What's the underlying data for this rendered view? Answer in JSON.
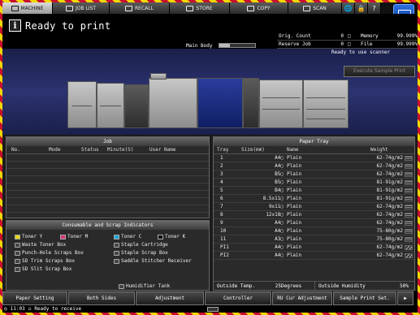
{
  "tabs": [
    {
      "label": "MACHINE",
      "icon": "machine-icon",
      "active": true
    },
    {
      "label": "JOB LIST",
      "icon": "job-list-icon",
      "active": false
    },
    {
      "label": "RECALL",
      "icon": "recall-icon",
      "active": false
    },
    {
      "label": "STORE",
      "icon": "store-icon",
      "active": false
    },
    {
      "label": "COPY",
      "icon": "copy-icon",
      "active": false
    },
    {
      "label": "SCAN",
      "icon": "scan-icon",
      "active": false
    }
  ],
  "tab_extras": {
    "globe": "🌐",
    "lock": "🔒",
    "help": "?"
  },
  "status": {
    "title": "Ready to print",
    "main_body_label": "Main Body",
    "main_body_level": 0.3,
    "orig_count_label": "Orig. Count",
    "orig_count_value": "0",
    "memory_label": "Memory",
    "memory_value": "99.999%",
    "reserve_job_label": "Reserve Job",
    "reserve_job_value": "0",
    "file_amount_label": "File Amount",
    "file_amount_value": "99.999%",
    "scanner_message": "Ready to use scanner",
    "exec_sample_label": "Execute Sample Print"
  },
  "job_panel": {
    "title": "Job",
    "columns": [
      "No.",
      "Mode",
      "Status",
      "Minute(S)",
      "User Name"
    ]
  },
  "consumables": {
    "title": "Consumable and Scrap Indicators",
    "items": [
      {
        "label": "Toner Y",
        "color": "y"
      },
      {
        "label": "Toner M",
        "color": "m"
      },
      {
        "label": "Toner C",
        "color": "c"
      },
      {
        "label": "Toner K",
        "color": "k"
      },
      {
        "label": "Waste Toner Box"
      },
      {
        "label": "Staple Cartridge"
      },
      {
        "label": "Punch-Hole Scraps Box"
      },
      {
        "label": "Staple Scrap Box"
      },
      {
        "label": "SD Trim Scraps Box"
      },
      {
        "label": "Saddle Stitcher Receiver"
      },
      {
        "label": "SD Slit Scrap Box"
      },
      {
        "label": "Humidifier Tank"
      }
    ]
  },
  "paper_tray": {
    "title": "Paper Tray",
    "columns": [
      "Tray",
      "Size(mm)",
      "Name",
      "Weight"
    ],
    "rows": [
      {
        "tray": "1",
        "size": "A4▢",
        "name": "Plain",
        "weight": "62-74g/m2",
        "hatch": false
      },
      {
        "tray": "2",
        "size": "A4▢",
        "name": "Plain",
        "weight": "62-74g/m2",
        "hatch": false
      },
      {
        "tray": "3",
        "size": "B5▢",
        "name": "Plain",
        "weight": "62-74g/m2",
        "hatch": false
      },
      {
        "tray": "4",
        "size": "B5▢",
        "name": "Plain",
        "weight": "81-91g/m2",
        "hatch": false
      },
      {
        "tray": "5",
        "size": "B4▢",
        "name": "Plain",
        "weight": "81-91g/m2",
        "hatch": false
      },
      {
        "tray": "6",
        "size": "8.5x11▢",
        "name": "Plain",
        "weight": "81-91g/m2",
        "hatch": false
      },
      {
        "tray": "7",
        "size": "9x11▢",
        "name": "Plain",
        "weight": "62-74g/m2",
        "hatch": false
      },
      {
        "tray": "8",
        "size": "12x18▢",
        "name": "Plain",
        "weight": "62-74g/m2",
        "hatch": false
      },
      {
        "tray": "9",
        "size": "A4▢",
        "name": "Plain",
        "weight": "62-74g/m2",
        "hatch": false
      },
      {
        "tray": "10",
        "size": "A4▢",
        "name": "Plain",
        "weight": "75-80g/m2",
        "hatch": false
      },
      {
        "tray": "11",
        "size": "A3▢",
        "name": "Plain",
        "weight": "75-80g/m2",
        "hatch": false
      },
      {
        "tray": "PI1",
        "size": "A4▢",
        "name": "Plain",
        "weight": "62-74g/m2",
        "hatch": true
      },
      {
        "tray": "PI2",
        "size": "A4▢",
        "name": "Plain",
        "weight": "62-74g/m2",
        "hatch": true
      }
    ],
    "outside_temp_label": "Outside Temp.",
    "outside_temp_value": "25Degrees",
    "outside_humidity_label": "Outside Humidity",
    "outside_humidity_value": "50%"
  },
  "bottom_buttons": [
    "Paper Setting",
    "Both Sides",
    "Adjustment",
    "Controller",
    "RU Cur Adjustment",
    "Sample Print Set.",
    "▶"
  ],
  "statusline": {
    "time": "11:03",
    "message": "Ready to receive"
  }
}
